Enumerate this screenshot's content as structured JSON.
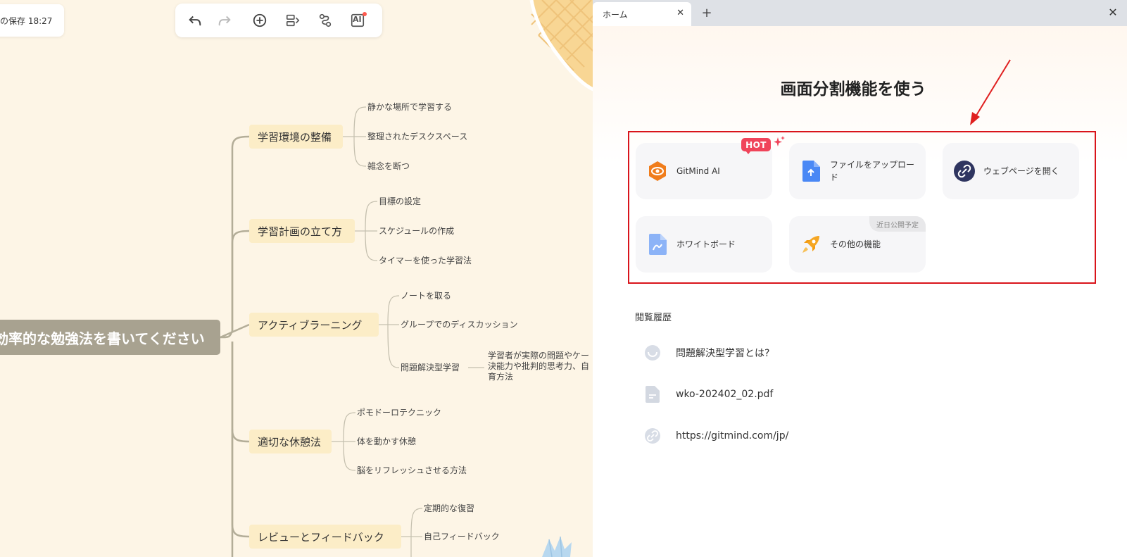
{
  "canvas": {
    "save_status": "の保存 18:27",
    "toolbar": {
      "undo_icon": "undo-icon",
      "redo_icon": "redo-icon",
      "add_icon": "add-node-icon",
      "layout_icon": "layout-icon",
      "connect_icon": "connect-icon",
      "ai_label": "AI"
    },
    "root_text": "効率的な勉強法を書いてください",
    "branches": [
      {
        "label": "学習環境の整備",
        "leaves": [
          "静かな場所で学習する",
          "整理されたデスクスペース",
          "雑念を断つ"
        ]
      },
      {
        "label": "学習計画の立て方",
        "leaves": [
          "目標の設定",
          "スケジュールの作成",
          "タイマーを使った学習法"
        ]
      },
      {
        "label": "アクティブラーニング",
        "leaves": [
          "ノートを取る",
          "グループでのディスカッション",
          "問題解決型学習"
        ]
      },
      {
        "label": "適切な休憩法",
        "leaves": [
          "ポモドーロテクニック",
          "体を動かす休憩",
          "脳をリフレッシュさせる方法"
        ]
      },
      {
        "label": "レビューとフィードバック",
        "leaves": [
          "定期的な復習",
          "自己フィードバック"
        ]
      }
    ],
    "detail_lines": [
      "学習者が実際の問題やケー",
      "決能力や批判的思考力、自",
      "育方法"
    ]
  },
  "panel": {
    "tab_label": "ホーム",
    "tab_close": "✕",
    "tab_add": "+",
    "window_close": "✕",
    "title": "画面分割機能を使う",
    "cards": [
      {
        "label": "GitMind AI",
        "icon": "gitmind-ai-icon",
        "badge": "HOT"
      },
      {
        "label": "ファイルをアップロード",
        "icon": "file-upload-icon"
      },
      {
        "label": "ウェブページを開く",
        "icon": "link-icon"
      },
      {
        "label": "ホワイトボード",
        "icon": "whiteboard-icon"
      },
      {
        "label": "その他の機能",
        "icon": "rocket-icon",
        "badge": "近日公開予定"
      }
    ],
    "history_title": "閲覧履歴",
    "history": [
      {
        "label": "問題解決型学習とは?",
        "icon": "chat-icon"
      },
      {
        "label": "wko-202402_02.pdf",
        "icon": "document-icon"
      },
      {
        "label": "https://gitmind.com/jp/",
        "icon": "link-icon"
      }
    ]
  },
  "colors": {
    "canvas_bg": "#fdf5e6",
    "root_bg": "#a8a290",
    "branch_bg": "#fcedc7",
    "highlight_red": "#d9141b",
    "hot_red": "#f0445a"
  }
}
